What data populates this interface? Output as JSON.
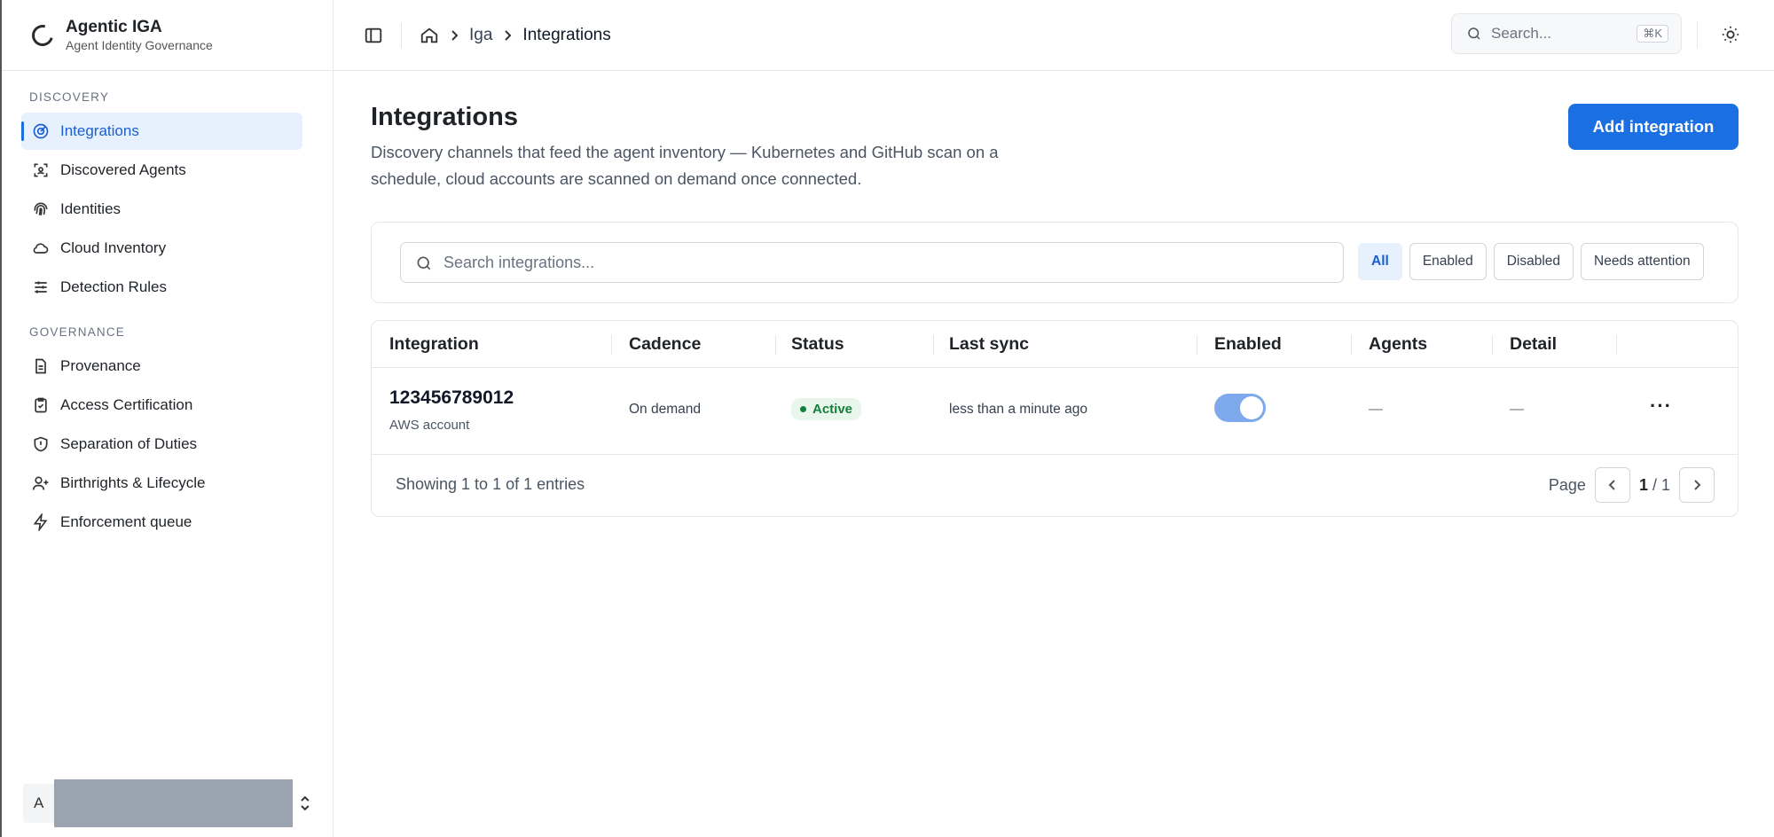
{
  "brand": {
    "title": "Agentic IGA",
    "subtitle": "Agent Identity Governance"
  },
  "sidebar": {
    "sections": [
      {
        "label": "DISCOVERY",
        "items": [
          {
            "label": "Integrations",
            "icon": "radar-icon",
            "active": true
          },
          {
            "label": "Discovered Agents",
            "icon": "scan-icon"
          },
          {
            "label": "Identities",
            "icon": "fingerprint-icon"
          },
          {
            "label": "Cloud Inventory",
            "icon": "cloud-icon"
          },
          {
            "label": "Detection Rules",
            "icon": "sliders-icon"
          }
        ]
      },
      {
        "label": "GOVERNANCE",
        "items": [
          {
            "label": "Provenance",
            "icon": "document-icon"
          },
          {
            "label": "Access Certification",
            "icon": "clipboard-check-icon"
          },
          {
            "label": "Separation of Duties",
            "icon": "shield-icon"
          },
          {
            "label": "Birthrights & Lifecycle",
            "icon": "user-plus-icon"
          },
          {
            "label": "Enforcement queue",
            "icon": "zap-icon"
          }
        ]
      }
    ],
    "user_initial": "A"
  },
  "topbar": {
    "breadcrumb": [
      "Iga",
      "Integrations"
    ],
    "search_placeholder": "Search...",
    "search_shortcut": "⌘K"
  },
  "page": {
    "title": "Integrations",
    "description": "Discovery channels that feed the agent inventory — Kubernetes and GitHub scan on a schedule, cloud accounts are scanned on demand once connected.",
    "add_button": "Add integration"
  },
  "filters": {
    "search_placeholder": "Search integrations...",
    "chips": [
      "All",
      "Enabled",
      "Disabled",
      "Needs attention"
    ],
    "active_chip": "All"
  },
  "table": {
    "columns": [
      "Integration",
      "Cadence",
      "Status",
      "Last sync",
      "Enabled",
      "Agents",
      "Detail"
    ],
    "rows": [
      {
        "name": "123456789012",
        "type": "AWS account",
        "cadence": "On demand",
        "status": "Active",
        "last_sync": "less than a minute ago",
        "enabled": true,
        "agents": "—",
        "detail": "—"
      }
    ],
    "footer": "Showing 1 to 1 of 1 entries",
    "page_label": "Page",
    "page_current": "1",
    "page_total": "/ 1"
  },
  "colors": {
    "accent": "#1a6fe3",
    "active_bg": "#e7f0fd",
    "status_green": "#15803d"
  }
}
